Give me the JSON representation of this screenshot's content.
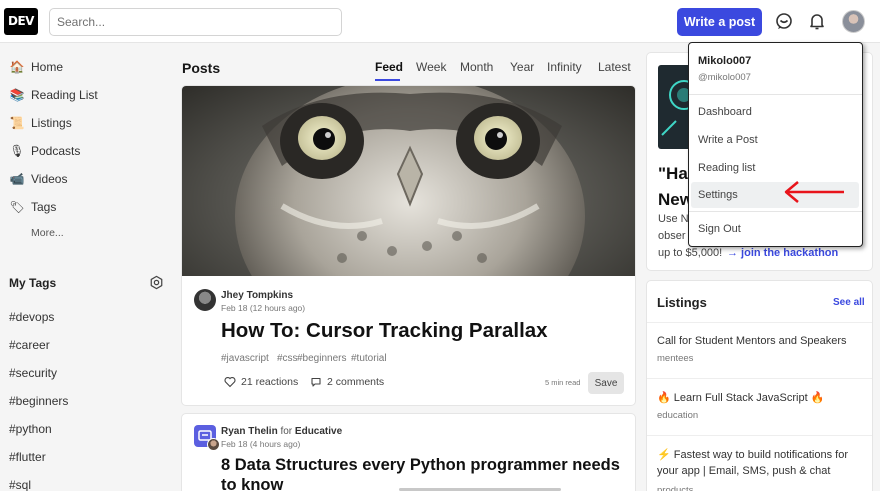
{
  "header": {
    "logo": "DEV",
    "search_placeholder": "Search...",
    "write_post": "Write a post"
  },
  "sidebar": {
    "nav": [
      {
        "emoji": "🏠",
        "label": "Home"
      },
      {
        "emoji": "📚",
        "label": "Reading List"
      },
      {
        "emoji": "📜",
        "label": "Listings"
      },
      {
        "emoji": "🎙",
        "label": "Podcasts"
      },
      {
        "emoji": "📹",
        "label": "Videos"
      },
      {
        "emoji": "🏷",
        "label": "Tags"
      }
    ],
    "more": "More...",
    "my_tags_title": "My Tags",
    "tags": [
      "#devops",
      "#career",
      "#security",
      "#beginners",
      "#python",
      "#flutter",
      "#sql"
    ]
  },
  "feed": {
    "title": "Posts",
    "tabs": [
      "Feed",
      "Week",
      "Month",
      "Year",
      "Infinity",
      "Latest"
    ],
    "active_tab": "Feed",
    "posts": [
      {
        "author": "Jhey Tompkins",
        "date": "Feb 18 (12 hours ago)",
        "title": "How To: Cursor Tracking Parallax",
        "tags": [
          "#javascript",
          "#css",
          "#beginners",
          "#tutorial"
        ],
        "reactions": "21 reactions",
        "comments": "2 comments",
        "read_time": "5 min read",
        "save": "Save"
      },
      {
        "author": "Ryan Thelin",
        "for": "for",
        "org": "Educative",
        "date": "Feb 18 (4 hours ago)",
        "title_line1": "8 Data Structures every Python programmer needs",
        "title_line2": "to know"
      }
    ]
  },
  "right": {
    "promo": {
      "heading_1": "\"Ha",
      "heading_2": "New",
      "line_1": "Use N",
      "line_2": "obser",
      "line_3": "up to $5,000!",
      "link": "→ join the hackathon"
    },
    "listings": {
      "title": "Listings",
      "see_all": "See all",
      "items": [
        {
          "title": "Call for Student Mentors and Speakers",
          "category": "mentees"
        },
        {
          "title": "🔥 Learn Full Stack JavaScript 🔥",
          "category": "education"
        },
        {
          "title": "⚡ Fastest way to build notifications for your app | Email, SMS, push & chat",
          "category": "products"
        }
      ]
    }
  },
  "dropdown": {
    "name": "Mikolo007",
    "handle": "@mikolo007",
    "items": [
      "Dashboard",
      "Write a Post",
      "Reading list",
      "Settings"
    ],
    "sign_out": "Sign Out",
    "highlighted": "Settings"
  },
  "colors": {
    "accent": "#3b49df",
    "arrow": "#e8141b"
  }
}
